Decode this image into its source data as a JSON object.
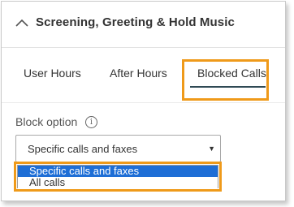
{
  "section": {
    "title": "Screening, Greeting & Hold Music",
    "collapse_icon": "chevron-up-icon"
  },
  "tabs": [
    {
      "label": "User Hours",
      "active": false
    },
    {
      "label": "After Hours",
      "active": false
    },
    {
      "label": "Blocked Calls",
      "active": true
    }
  ],
  "block_option": {
    "label": "Block option",
    "info_icon": "info-icon",
    "info_glyph": "i",
    "selected_value": "Specific calls and faxes",
    "caret": "▼",
    "options": [
      {
        "label": "Specific calls and faxes",
        "highlighted": true
      },
      {
        "label": "All calls",
        "highlighted": false
      }
    ]
  },
  "colors": {
    "highlight_frame": "#ef9a1a",
    "active_tab_underline": "#2f4a54",
    "selected_option_bg": "#1e6ed6"
  }
}
